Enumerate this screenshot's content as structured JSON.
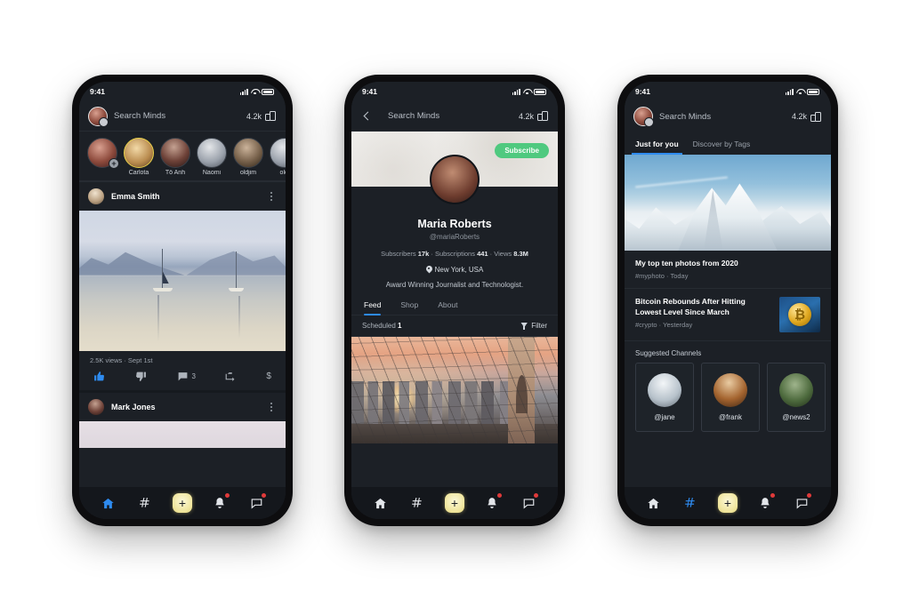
{
  "status_bar": {
    "time": "9:41",
    "signal_icon": "cellular-signal-icon",
    "wifi_icon": "wifi-icon",
    "battery_icon": "battery-icon"
  },
  "phone1": {
    "topbar": {
      "title": "Search Minds",
      "tokens": "4.2k",
      "tokens_icon": "coins-icon",
      "avatar": "user-avatar"
    },
    "stories": [
      {
        "name": "",
        "badge": "+",
        "ring": "plain"
      },
      {
        "name": "Carlota",
        "ring": "yellow"
      },
      {
        "name": "Tô Anh",
        "ring": "plain"
      },
      {
        "name": "Naomi",
        "ring": "plain"
      },
      {
        "name": "oldjim",
        "ring": "plain"
      },
      {
        "name": "oldj",
        "ring": "plain"
      }
    ],
    "posts": [
      {
        "author": "Emma Smith",
        "media_alt": "lake-with-sailboats-photo",
        "stats": "2.5K views · Sept 1st",
        "actions": {
          "thumb_up": "",
          "thumb_down": "",
          "comments": "3",
          "remind": "",
          "tip": "$"
        }
      },
      {
        "author": "Mark Jones",
        "media_alt": "cloudy-sky-photo"
      }
    ]
  },
  "phone2": {
    "topbar": {
      "title": "Search Minds",
      "tokens": "4.2k",
      "back_icon": "back-chevron-icon",
      "tokens_icon": "coins-icon"
    },
    "profile": {
      "subscribe_label": "Subscribe",
      "name": "Maria Roberts",
      "handle": "@mariaRoberts",
      "stats_label_subscribers": "Subscribers",
      "stats_value_subscribers": "17k",
      "stats_label_subscriptions": "Subscriptions",
      "stats_value_subscriptions": "441",
      "stats_label_views": "Views",
      "stats_value_views": "8.3M",
      "location": "New York, USA",
      "bio": "Award Winning Journalist and Technologist.",
      "tabs": [
        {
          "label": "Feed",
          "active": true
        },
        {
          "label": "Shop",
          "active": false
        },
        {
          "label": "About",
          "active": false
        }
      ],
      "scheduled_label": "Scheduled",
      "scheduled_count": "1",
      "filter_label": "Filter",
      "media_alt": "brooklyn-bridge-sunset-photo"
    }
  },
  "phone3": {
    "topbar": {
      "title": "Search Minds",
      "tokens": "4.2k",
      "tokens_icon": "coins-icon",
      "avatar": "user-avatar"
    },
    "tabs": [
      {
        "label": "Just for you",
        "active": true
      },
      {
        "label": "Discover by Tags",
        "active": false
      }
    ],
    "hero_media_alt": "snow-covered-mountains-photo",
    "feed": [
      {
        "title": "My top ten photos from 2020",
        "meta": "#myphoto · Today",
        "thumb": "none"
      },
      {
        "title": "Bitcoin Rebounds After Hitting Lowest Level Since March",
        "meta": "#crypto · Yesterday",
        "thumb": "bitcoin-coin-thumbnail"
      }
    ],
    "suggested": {
      "title": "Suggested Channels",
      "channels": [
        {
          "handle": "@jane",
          "avatar": "jane-avatar"
        },
        {
          "handle": "@frank",
          "avatar": "frank-avatar"
        },
        {
          "handle": "@news2",
          "avatar": "news2-avatar"
        }
      ]
    }
  },
  "bottom_nav": {
    "items": [
      {
        "name": "home",
        "icon": "home-icon",
        "badge": false
      },
      {
        "name": "tags",
        "icon": "hashtag-icon",
        "badge": false
      },
      {
        "name": "compose",
        "icon": "plus-icon",
        "label": "+",
        "badge": false
      },
      {
        "name": "notifications",
        "icon": "bell-icon",
        "badge": true
      },
      {
        "name": "messages",
        "icon": "chat-icon",
        "badge": true
      }
    ]
  },
  "colors": {
    "accent_blue": "#2e8bef",
    "accent_green": "#4fc97f",
    "accent_yellow": "#efe49a",
    "badge_red": "#e03a3a",
    "screen_bg": "#1c2026",
    "nav_bg": "#14171c",
    "page_bg": "#ffffff"
  }
}
